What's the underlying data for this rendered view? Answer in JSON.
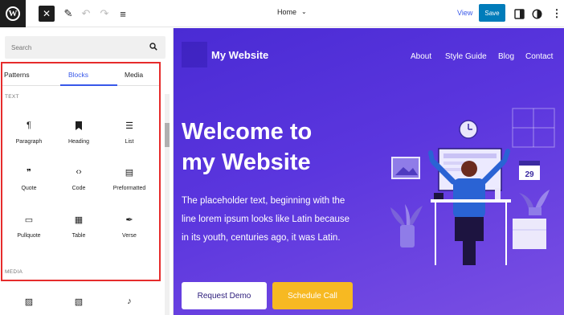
{
  "toolbar": {
    "logo_glyph": "W",
    "close_glyph": "✕",
    "pen_glyph": "✎",
    "undo_glyph": "↶",
    "redo_glyph": "↷",
    "list_glyph": "≡",
    "document_title": "Home",
    "document_chevron": "⌄",
    "view_label": "View",
    "save_label": "Save",
    "kebab_glyph": "⋮",
    "accent": "#007cba"
  },
  "inserter": {
    "search_placeholder": "Search",
    "tabs": [
      "Patterns",
      "Blocks",
      "Media"
    ],
    "active_tab": "Blocks",
    "sections": {
      "text": "TEXT",
      "media": "MEDIA"
    },
    "text_blocks": [
      {
        "label": "Paragraph",
        "icon": "paragraph-icon",
        "glyph": "¶"
      },
      {
        "label": "Heading",
        "icon": "heading-icon",
        "glyph": "🔖"
      },
      {
        "label": "List",
        "icon": "list-icon",
        "glyph": "☰"
      },
      {
        "label": "Quote",
        "icon": "quote-icon",
        "glyph": "❞"
      },
      {
        "label": "Code",
        "icon": "code-icon",
        "glyph": "‹›"
      },
      {
        "label": "Preformatted",
        "icon": "preformatted-icon",
        "glyph": "▤"
      },
      {
        "label": "Pullquote",
        "icon": "pullquote-icon",
        "glyph": "▭"
      },
      {
        "label": "Table",
        "icon": "table-icon",
        "glyph": "▦"
      },
      {
        "label": "Verse",
        "icon": "verse-icon",
        "glyph": "✒"
      }
    ],
    "media_blocks": [
      {
        "icon": "image-icon",
        "glyph": "▨"
      },
      {
        "icon": "gallery-icon",
        "glyph": "▧"
      },
      {
        "icon": "audio-icon",
        "glyph": "♪"
      }
    ],
    "highlight_color": "#e62c2c",
    "active_tab_color": "#3858e9"
  },
  "site": {
    "title": "My Website",
    "nav": [
      "About",
      "Style Guide",
      "Blog",
      "Contact"
    ],
    "hero_title": "Welcome to my Website",
    "hero_text": "The placeholder text, beginning with the line lorem ipsum looks like Latin because in its youth, centuries ago, it was Latin.",
    "primary_button": "Request Demo",
    "secondary_button": "Schedule Call",
    "calendar_day": "29",
    "background_start": "#4a2bd4",
    "background_end": "#7a4fe3",
    "secondary_button_color": "#f7b922"
  }
}
